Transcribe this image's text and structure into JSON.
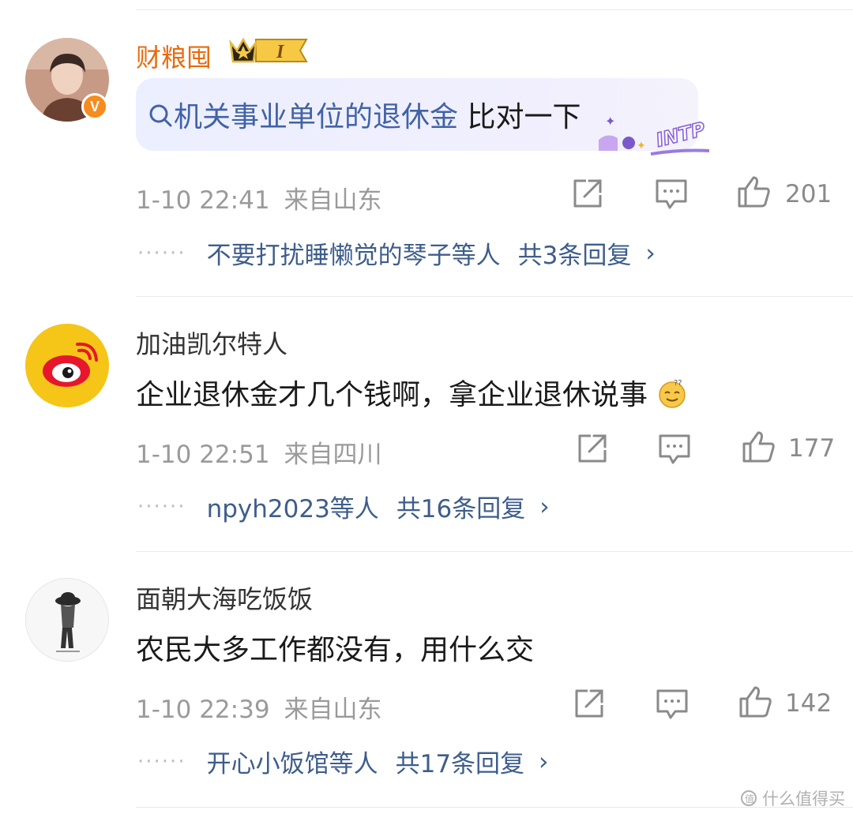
{
  "comments": [
    {
      "username": "财粮囤",
      "badge_level": "I",
      "verified": "V",
      "search_link": "机关事业单位的退休金",
      "text_rest": " 比对一下",
      "sticker_text": "INTP",
      "time": "1-10 22:41",
      "location": "来自山东",
      "likes": "201",
      "replies": {
        "dots": "······",
        "users": "不要打扰睡懒觉的琴子等人",
        "total": "共3条回复",
        "chevron": "›"
      }
    },
    {
      "username": "加油凯尔特人",
      "text": "企业退休金才几个钱啊，拿企业退休说事",
      "time": "1-10 22:51",
      "location": "来自四川",
      "likes": "177",
      "replies": {
        "dots": "······",
        "users": "npyh2023等人",
        "total": "共16条回复",
        "chevron": "›"
      }
    },
    {
      "username": "面朝大海吃饭饭",
      "text": "农民大多工作都没有，用什么交",
      "time": "1-10 22:39",
      "location": "来自山东",
      "likes": "142",
      "replies": {
        "dots": "······",
        "users": "开心小饭馆等人",
        "total": "共17条回复",
        "chevron": "›"
      }
    }
  ],
  "icons": {
    "share": "share-icon",
    "comment": "comment-icon",
    "like": "like-icon",
    "search": "search-icon"
  },
  "colors": {
    "vip_name": "#e86b0c",
    "link": "#3e5d8c",
    "search_link": "#4163a6",
    "meta": "#9a9a9a"
  },
  "watermark": "什么值得买"
}
